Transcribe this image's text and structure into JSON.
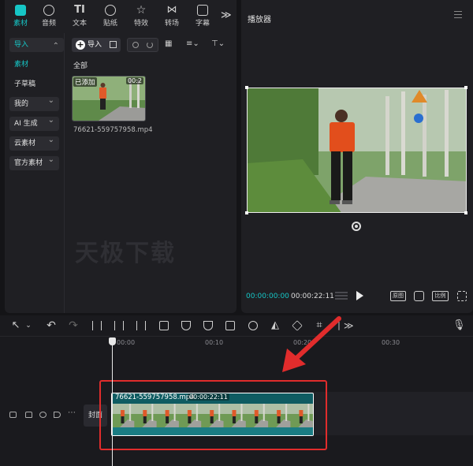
{
  "toolbar": {
    "tabs": [
      {
        "label": "素材",
        "icon": "media-icon",
        "active": true
      },
      {
        "label": "音频",
        "icon": "audio-icon",
        "active": false
      },
      {
        "label": "文本",
        "icon": "text-icon",
        "active": false
      },
      {
        "label": "贴纸",
        "icon": "sticker-icon",
        "active": false
      },
      {
        "label": "特效",
        "icon": "effects-icon",
        "active": false
      },
      {
        "label": "转场",
        "icon": "transition-icon",
        "active": false
      },
      {
        "label": "字幕",
        "icon": "subtitle-icon",
        "active": false
      }
    ],
    "more": "≫"
  },
  "sidebar": {
    "items": [
      {
        "label": "导入"
      },
      {
        "label": "素材"
      },
      {
        "label": "子草稿"
      },
      {
        "label": "我的"
      },
      {
        "label": "AI 生成"
      },
      {
        "label": "云素材"
      },
      {
        "label": "官方素材"
      }
    ]
  },
  "content": {
    "import_label": "导入",
    "section_label": "全部",
    "thumb": {
      "added_badge": "已添加",
      "duration": "00:2",
      "filename": "76621-559757958.mp4"
    }
  },
  "watermark": "天极下载",
  "player": {
    "title": "播放器",
    "time_current": "00:00:00:00",
    "time_total": "00:00:22:11",
    "btn_labels": [
      "原图",
      "",
      "比例",
      ""
    ]
  },
  "timeline": {
    "ruler_labels": [
      "00:00",
      "00:10",
      "00:20",
      "00:30"
    ],
    "cover_label": "封面",
    "clip": {
      "title": "76621-559757958.mp4",
      "duration": "00:00:22:11"
    }
  },
  "colors": {
    "accent": "#16c6c6",
    "clip": "#0f5c62",
    "highlight": "#e12c2c"
  }
}
